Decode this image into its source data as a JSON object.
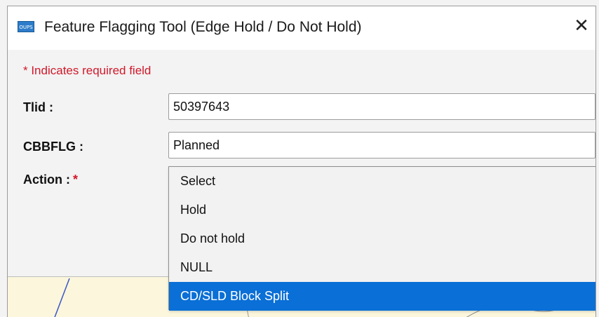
{
  "window": {
    "title": "Feature Flagging Tool (Edge Hold / Do Not Hold)",
    "app_icon_text": "OUPS",
    "close_glyph": "✕"
  },
  "form": {
    "required_note": "* Indicates required field",
    "tlid": {
      "label": "Tlid :",
      "value": "50397643"
    },
    "cbbflg": {
      "label": "CBBFLG :",
      "value": "Planned"
    },
    "action": {
      "label": "Action :",
      "required_marker": "*",
      "options": [
        "Select",
        "Hold",
        "Do not hold",
        "NULL",
        "CD/SLD Block Split"
      ],
      "highlighted_index": 4
    }
  },
  "colors": {
    "required_red": "#d0182a",
    "highlight_blue": "#0a6fd6",
    "map_background": "#fbf6dc"
  }
}
